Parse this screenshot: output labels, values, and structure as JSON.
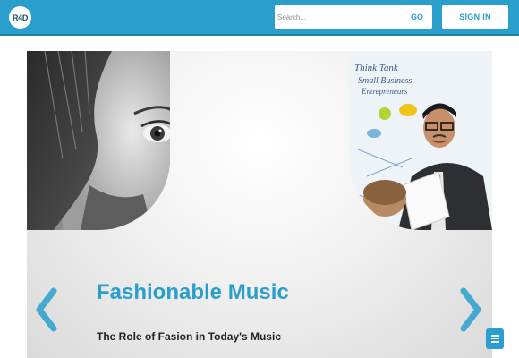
{
  "header": {
    "logo_text": "R4D",
    "search": {
      "placeholder": "Search...",
      "value": "",
      "button_label": "GO"
    },
    "signin_label": "SIGN IN"
  },
  "slider": {
    "title": "Fashionable Music",
    "subtitle": "The Role of Fasion in Today's Music",
    "prev_icon": "chevron-left-icon",
    "next_icon": "chevron-right-icon",
    "left_image": "grayscale-woman-face-photo",
    "right_image": "man-presenting-whiteboard-photo"
  },
  "menu_button": {
    "icon": "hamburger-menu-icon"
  },
  "colors": {
    "brand": "#2a9fcb",
    "brand_dark": "#1f7fa3",
    "text": "#222222"
  }
}
